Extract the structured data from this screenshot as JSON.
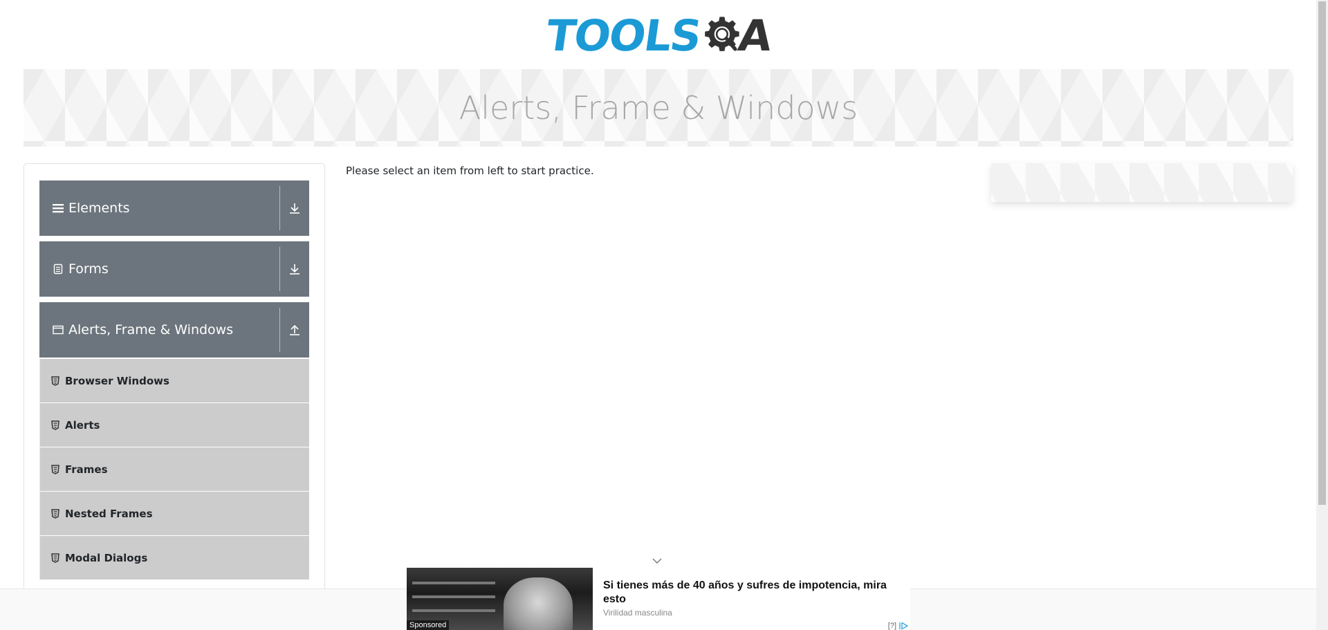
{
  "header": {
    "logo_text_left": "TOOLS",
    "logo_text_right": "A",
    "logo_color": "#1b9ad6"
  },
  "banner": {
    "title": "Alerts, Frame & Windows"
  },
  "sidebar": {
    "groups": [
      {
        "label": "Elements",
        "icon": "hamburger-icon",
        "state": "collapsed",
        "arrow": "download-arrow-icon"
      },
      {
        "label": "Forms",
        "icon": "document-icon",
        "state": "collapsed",
        "arrow": "download-arrow-icon"
      },
      {
        "label": "Alerts, Frame & Windows",
        "icon": "window-icon",
        "state": "expanded",
        "arrow": "upload-arrow-icon"
      }
    ],
    "items": [
      {
        "label": "Browser Windows",
        "icon": "html5-icon"
      },
      {
        "label": "Alerts",
        "icon": "html5-icon"
      },
      {
        "label": "Frames",
        "icon": "html5-icon"
      },
      {
        "label": "Nested Frames",
        "icon": "html5-icon"
      },
      {
        "label": "Modal Dialogs",
        "icon": "html5-icon"
      }
    ],
    "header_color": "#6c757d",
    "item_color": "#cccccc"
  },
  "main": {
    "instruction": "Please select an item from left to start practice."
  },
  "ad": {
    "sponsored_label": "Sponsored",
    "title": "Si tienes más de 40 años y sufres de impotencia, mira esto",
    "source": "Virilidad masculina",
    "info_label": "[?]"
  }
}
